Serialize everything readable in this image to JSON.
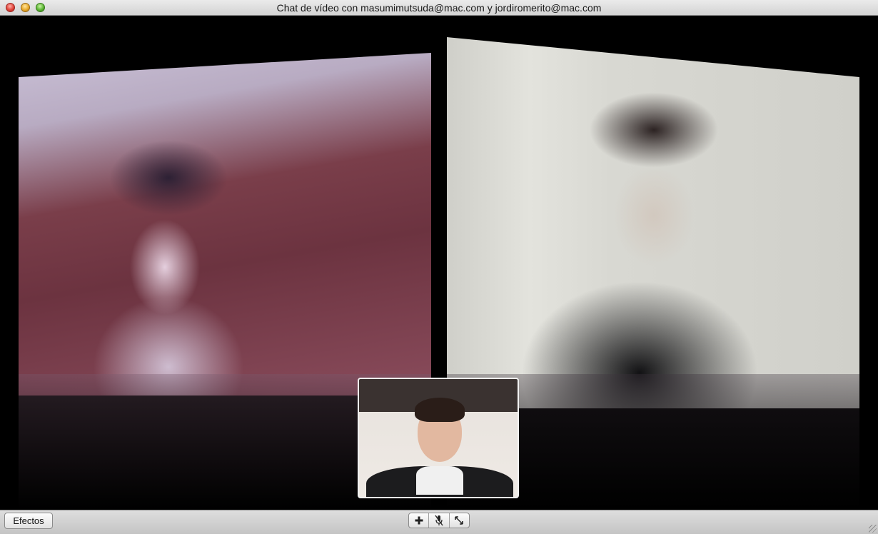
{
  "window": {
    "title": "Chat de vídeo con masumimutsuda@mac.com y jordiromerito@mac.com",
    "controls": [
      "close-icon",
      "minimize-icon",
      "zoom-icon"
    ]
  },
  "videos": {
    "left": {
      "participant": "masumimutsuda@mac.com"
    },
    "right": {
      "participant": "jordiromerito@mac.com"
    },
    "self_preview": {
      "participant": "self"
    }
  },
  "toolbar": {
    "effects_label": "Efectos",
    "buttons": [
      {
        "icon": "add-participant-icon"
      },
      {
        "icon": "mute-microphone-icon"
      },
      {
        "icon": "fullscreen-icon"
      }
    ]
  },
  "colors": {
    "titlebar_bg": "#d3d3d3",
    "stage_bg": "#000000",
    "toolbar_bg": "#c4c4c4"
  }
}
